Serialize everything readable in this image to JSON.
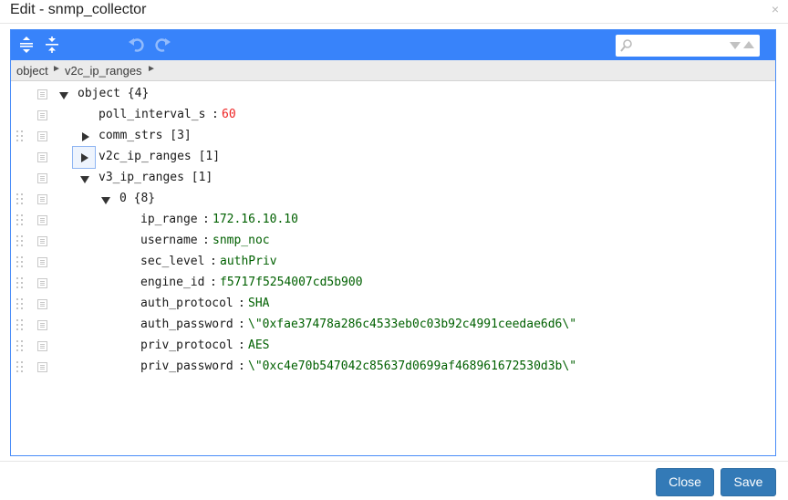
{
  "dialog": {
    "title": "Edit - snmp_collector",
    "close_glyph": "×"
  },
  "toolbar": {
    "expand_all_icon": "expand-all-icon",
    "collapse_all_icon": "collapse-all-icon",
    "undo_icon": "undo-icon",
    "redo_icon": "redo-icon",
    "search_icon": "search-icon",
    "search_value": "",
    "accent_color": "#3883fa"
  },
  "breadcrumb": {
    "items": [
      "object",
      "v2c_ip_ranges"
    ],
    "separator": "►"
  },
  "tree": {
    "rows": [
      {
        "key": "object {4}"
      },
      {
        "key": "poll_interval_s",
        "value": "60"
      },
      {
        "key": "comm_strs [3]"
      },
      {
        "key": "v2c_ip_ranges [1]"
      },
      {
        "key": "v3_ip_ranges [1]"
      },
      {
        "key": "0 {8}"
      },
      {
        "key": "ip_range",
        "value": "172.16.10.10"
      },
      {
        "key": "username",
        "value": "snmp_noc"
      },
      {
        "key": "sec_level",
        "value": "authPriv"
      },
      {
        "key": "engine_id",
        "value": "f5717f5254007cd5b900"
      },
      {
        "key": "auth_protocol",
        "value": "SHA"
      },
      {
        "key": "auth_password",
        "value": "\\\"0xfae37478a286c4533eb0c03b92c4991ceedae6d6\\\""
      },
      {
        "key": "priv_protocol",
        "value": "AES"
      },
      {
        "key": "priv_password",
        "value": "\\\"0xc4e70b547042c85637d0699af468961672530d3b\\\""
      }
    ],
    "colon": ":"
  },
  "footer": {
    "close_label": "Close",
    "save_label": "Save",
    "button_color": "#337ab7"
  }
}
